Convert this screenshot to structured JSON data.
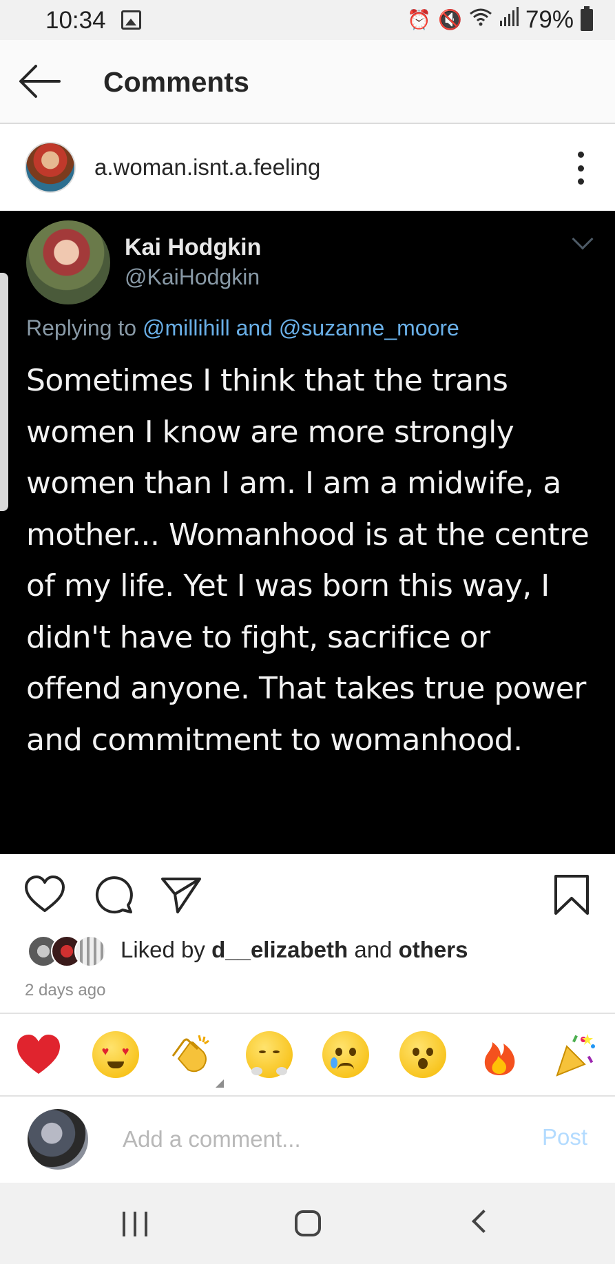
{
  "status_bar": {
    "time": "10:34",
    "battery_percent": "79%",
    "icons": [
      "image-icon",
      "alarm-icon",
      "mute-icon",
      "wifi-icon",
      "signal-icon",
      "battery-icon"
    ]
  },
  "header": {
    "title": "Comments"
  },
  "post": {
    "username": "a.woman.isnt.a.feeling"
  },
  "tweet": {
    "name": "Kai Hodgkin",
    "handle": "@KaiHodgkin",
    "replying_prefix": "Replying to",
    "replying_mentions": "@millihill and @suzanne_moore",
    "text": "Sometimes I think that the trans women I know are more strongly women than I am. I am a midwife, a mother... Womanhood is at the centre of my life. Yet I was born this way, I didn't have to fight, sacrifice or offend anyone. That takes true power and commitment to womanhood."
  },
  "likes": {
    "prefix": "Liked by",
    "user": "d__elizabeth",
    "conjunction": "and",
    "others": "others"
  },
  "timestamp": "2 days ago",
  "emoji_bar": [
    "❤️",
    "😍",
    "👏",
    "😤",
    "😢",
    "😮",
    "🔥",
    "🎉"
  ],
  "comment_box": {
    "placeholder": "Add a comment...",
    "post_label": "Post"
  },
  "colors": {
    "link_blue": "#6ab0e8",
    "post_button_disabled": "#b3dbff",
    "tweet_background": "#000000"
  }
}
